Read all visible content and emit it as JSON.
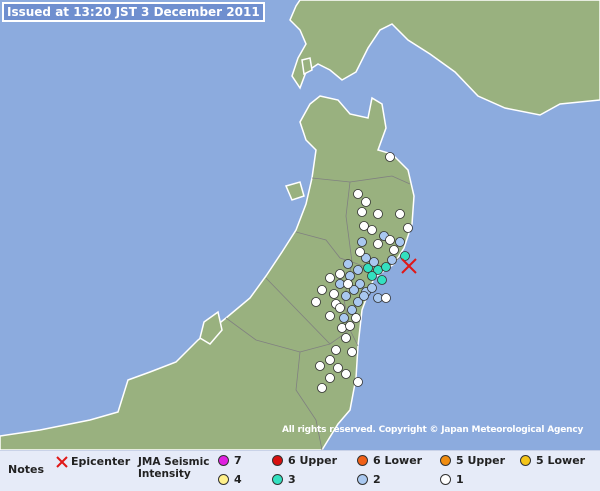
{
  "header": {
    "issued": "Issued at 13:20 JST  3 December 2011"
  },
  "map": {
    "copyright": "All rights reserved. Copyright © Japan Meteorological Agency",
    "colors": {
      "sea": "#8cabde",
      "land": "#99b17f",
      "coast": "#ffffff"
    },
    "epicenter_icon": "red-x-icon"
  },
  "legend": {
    "notes": "Notes",
    "epicenter": "Epicenter",
    "jma_title": "JMA Seismic",
    "jma_subtitle": "Intensity",
    "items": [
      {
        "label": "7",
        "color": "#e020e0"
      },
      {
        "label": "6 Upper",
        "color": "#d81010"
      },
      {
        "label": "6 Lower",
        "color": "#f06018"
      },
      {
        "label": "5 Upper",
        "color": "#f08c10"
      },
      {
        "label": "5 Lower",
        "color": "#f4c418"
      },
      {
        "label": "4",
        "color": "#fff08a"
      },
      {
        "label": "3",
        "color": "#33e0c0"
      },
      {
        "label": "2",
        "color": "#a9c8f0"
      },
      {
        "label": "1",
        "color": "#ffffff"
      }
    ]
  }
}
